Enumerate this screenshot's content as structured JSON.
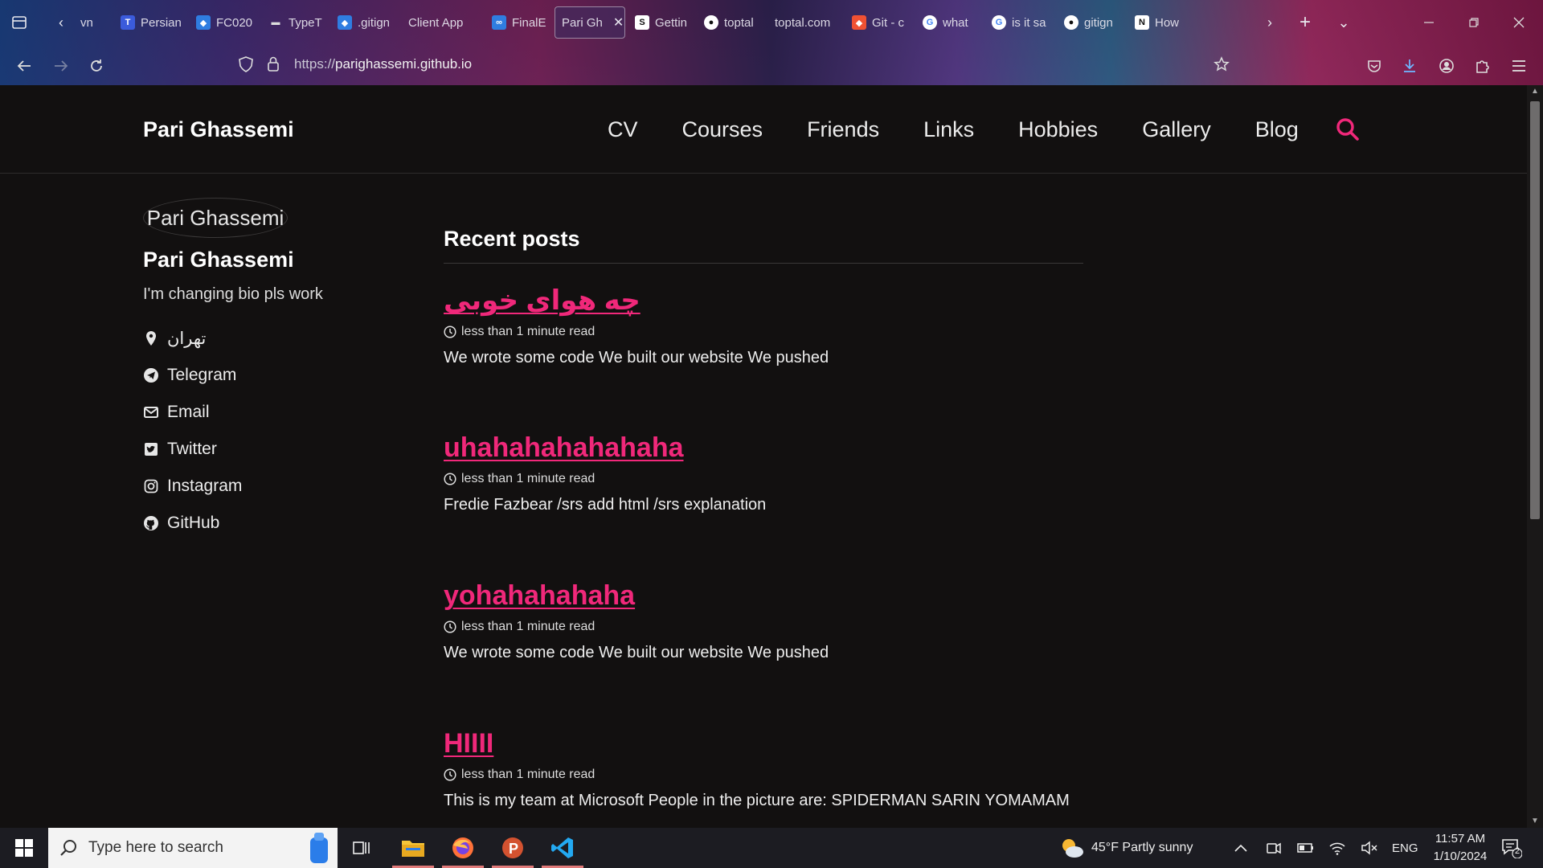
{
  "browser": {
    "tabs": [
      {
        "label": "vn",
        "favicon": "generic",
        "color": "#4a4a6a"
      },
      {
        "label": "Persian",
        "favicon": "typeform",
        "color": "#3b5bdb"
      },
      {
        "label": "FC020",
        "favicon": "azure",
        "color": "#2f7de1"
      },
      {
        "label": "TypeT",
        "favicon": "page",
        "color": "#dddddd"
      },
      {
        "label": ".gitign",
        "favicon": "azure",
        "color": "#2f7de1"
      },
      {
        "label": "Client App",
        "favicon": "none",
        "color": "#000000"
      },
      {
        "label": "FinalE",
        "favicon": "oo",
        "color": "#2f7de1"
      },
      {
        "label": "Pari Gh",
        "favicon": "none",
        "color": "#000000",
        "active": true
      },
      {
        "label": "Gettin",
        "favicon": "s-letter",
        "color": "#ffffff"
      },
      {
        "label": "toptal",
        "favicon": "github",
        "color": "#ffffff"
      },
      {
        "label": "toptal.com",
        "favicon": "none",
        "color": "#000000"
      },
      {
        "label": "Git - c",
        "favicon": "git",
        "color": "#f05133"
      },
      {
        "label": "what",
        "favicon": "google",
        "color": "#ffffff"
      },
      {
        "label": "is it sa",
        "favicon": "google",
        "color": "#ffffff"
      },
      {
        "label": "gitign",
        "favicon": "github",
        "color": "#ffffff"
      },
      {
        "label": "How",
        "favicon": "notion",
        "color": "#ffffff"
      }
    ],
    "url_scheme": "https://",
    "url_host": "parighassemi.github.io"
  },
  "site": {
    "title": "Pari Ghassemi",
    "nav": [
      "CV",
      "Courses",
      "Friends",
      "Links",
      "Hobbies",
      "Gallery",
      "Blog"
    ],
    "accent": "#f0287a"
  },
  "author": {
    "avatar_alt": "Pari Ghassemi",
    "name": "Pari Ghassemi",
    "bio": "I'm changing bio pls work",
    "links": [
      {
        "icon": "location-icon",
        "label": "تهران"
      },
      {
        "icon": "telegram-icon",
        "label": "Telegram"
      },
      {
        "icon": "email-icon",
        "label": "Email"
      },
      {
        "icon": "twitter-icon",
        "label": "Twitter"
      },
      {
        "icon": "instagram-icon",
        "label": "Instagram"
      },
      {
        "icon": "github-icon",
        "label": "GitHub"
      }
    ]
  },
  "main": {
    "heading": "Recent posts",
    "posts": [
      {
        "title": "چه هوای خوبی",
        "meta": "less than 1 minute read",
        "excerpt": "We wrote some code We built our website We pushed"
      },
      {
        "title": "uhahahahahahaha",
        "meta": "less than 1 minute read",
        "excerpt": "Fredie Fazbear /srs add html /srs explanation"
      },
      {
        "title": "yohahahahaha",
        "meta": "less than 1 minute read",
        "excerpt": "We wrote some code We built our website We pushed"
      },
      {
        "title": "HIIII",
        "meta": "less than 1 minute read",
        "excerpt": "This is my team at Microsoft People in the picture are: SPIDERMAN SARIN YOMAMAM"
      }
    ]
  },
  "taskbar": {
    "search_placeholder": "Type here to search",
    "weather": "45°F  Partly sunny",
    "language": "ENG",
    "time": "11:57 AM",
    "date": "1/10/2024",
    "notifications": "2"
  }
}
